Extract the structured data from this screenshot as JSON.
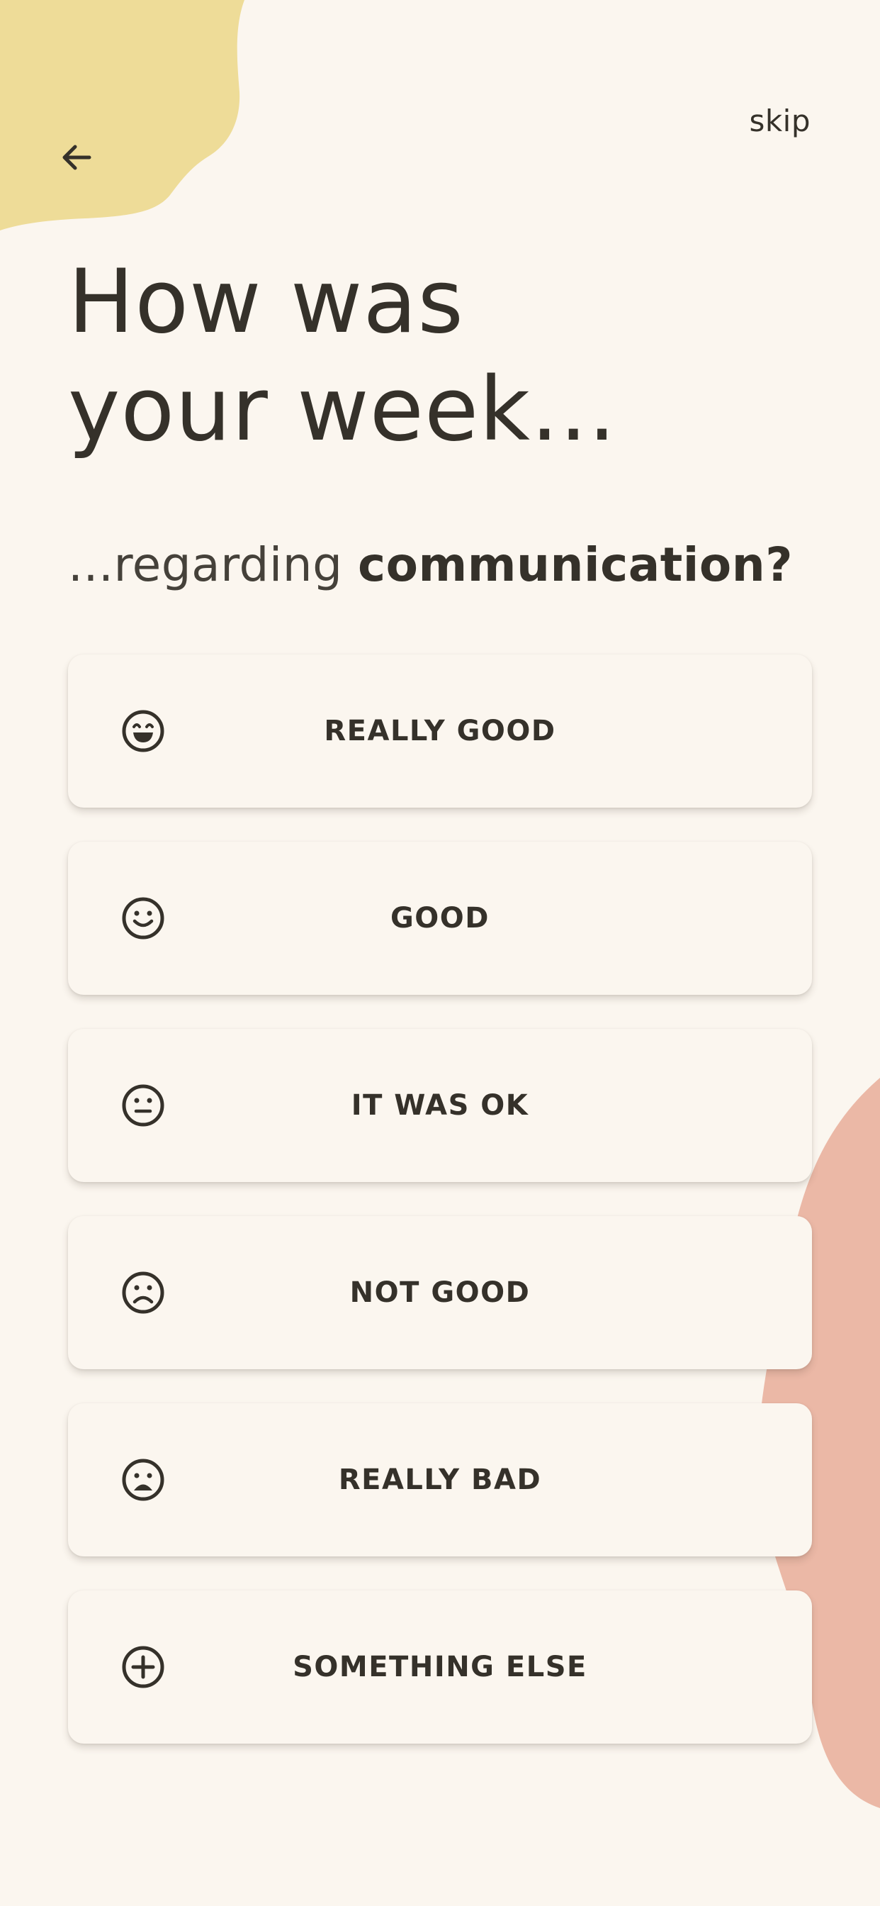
{
  "colors": {
    "background": "#FBF6EF",
    "text": "#35312A",
    "blob_yellow": "#EEDC98",
    "blob_pink": "#EBB8A6"
  },
  "header": {
    "back_icon": "arrow-left-icon",
    "skip_label": "skip"
  },
  "title": {
    "line1": "How was",
    "line2": "your week..."
  },
  "subtitle": {
    "prefix": "...regarding ",
    "topic": "communication?"
  },
  "options": [
    {
      "label": "REALLY GOOD",
      "icon": "grinning-face-icon"
    },
    {
      "label": "GOOD",
      "icon": "smiling-face-icon"
    },
    {
      "label": "IT WAS OK",
      "icon": "neutral-face-icon"
    },
    {
      "label": "NOT GOOD",
      "icon": "frowning-face-icon"
    },
    {
      "label": "REALLY BAD",
      "icon": "sad-face-icon"
    },
    {
      "label": "SOMETHING ELSE",
      "icon": "plus-circle-icon"
    }
  ]
}
